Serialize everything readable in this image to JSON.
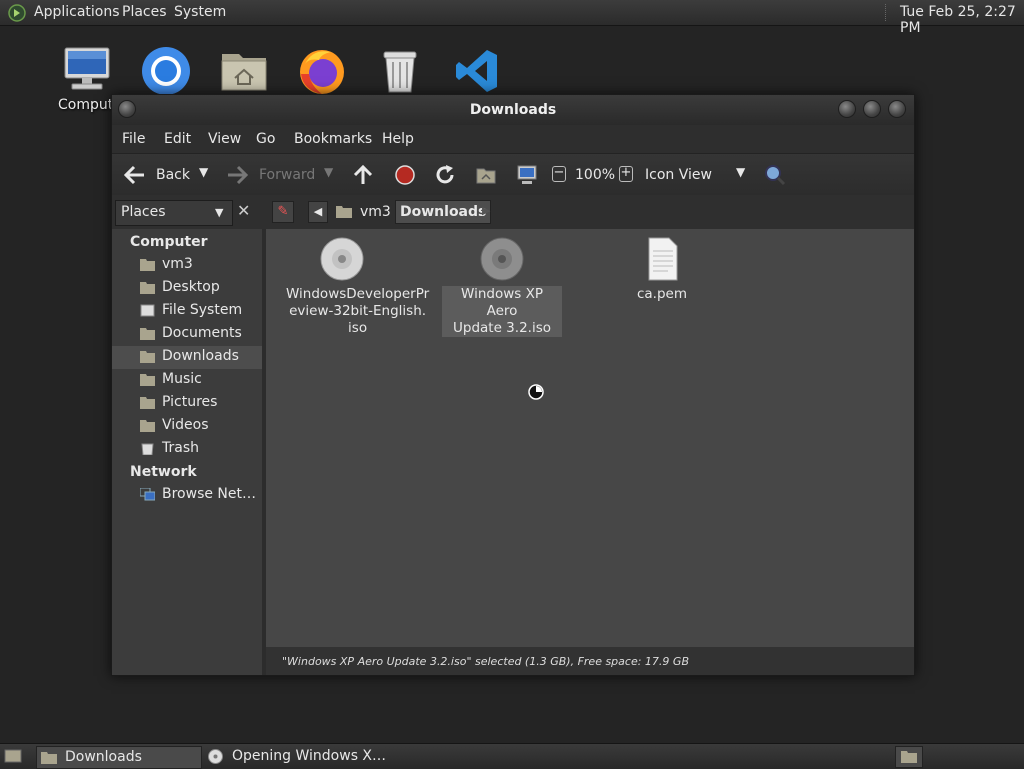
{
  "top_panel": {
    "menus": [
      "Applications",
      "Places",
      "System"
    ],
    "clock": "Tue Feb 25,  2:27 PM"
  },
  "desktop": {
    "icons": [
      {
        "name": "computer",
        "label": "Computer"
      },
      {
        "name": "chromium",
        "label": ""
      },
      {
        "name": "home-folder",
        "label": ""
      },
      {
        "name": "firefox",
        "label": ""
      },
      {
        "name": "trash",
        "label": ""
      },
      {
        "name": "vscode",
        "label": ""
      }
    ]
  },
  "window": {
    "title": "Downloads",
    "menu": [
      "File",
      "Edit",
      "View",
      "Go",
      "Bookmarks",
      "Help"
    ],
    "toolbar": {
      "back": "Back",
      "forward": "Forward",
      "zoom": "100%",
      "view_mode": "Icon View"
    },
    "sidebar": {
      "combo": "Places",
      "sections": [
        {
          "title": "Computer",
          "items": [
            "vm3",
            "Desktop",
            "File System",
            "Documents",
            "Downloads",
            "Music",
            "Pictures",
            "Videos",
            "Trash"
          ]
        },
        {
          "title": "Network",
          "items": [
            "Browse Net…"
          ]
        }
      ],
      "selected": "Downloads"
    },
    "path": [
      "vm3",
      "Downloads"
    ],
    "files": [
      {
        "name_lines": [
          "WindowsDeveloperPr",
          "eview-32bit-English.",
          "iso"
        ],
        "type": "disc",
        "selected": false
      },
      {
        "name_lines": [
          "Windows XP Aero",
          "Update 3.2.iso"
        ],
        "type": "disc",
        "selected": true
      },
      {
        "name_lines": [
          "ca.pem"
        ],
        "type": "document",
        "selected": false
      }
    ],
    "status": "\"Windows XP Aero Update 3.2.iso\" selected (1.3 GB), Free space: 17.9 GB"
  },
  "bottom_panel": {
    "tasks": [
      {
        "label": "Downloads",
        "active": true
      },
      {
        "label": "Opening Windows X…",
        "active": false
      }
    ]
  },
  "colors": {
    "panel": "#2b2b2b",
    "content_bg": "#474747",
    "sidebar_bg": "#3c3c3c",
    "record_red": "#c0392b",
    "vscode_blue": "#2a8ad8"
  }
}
